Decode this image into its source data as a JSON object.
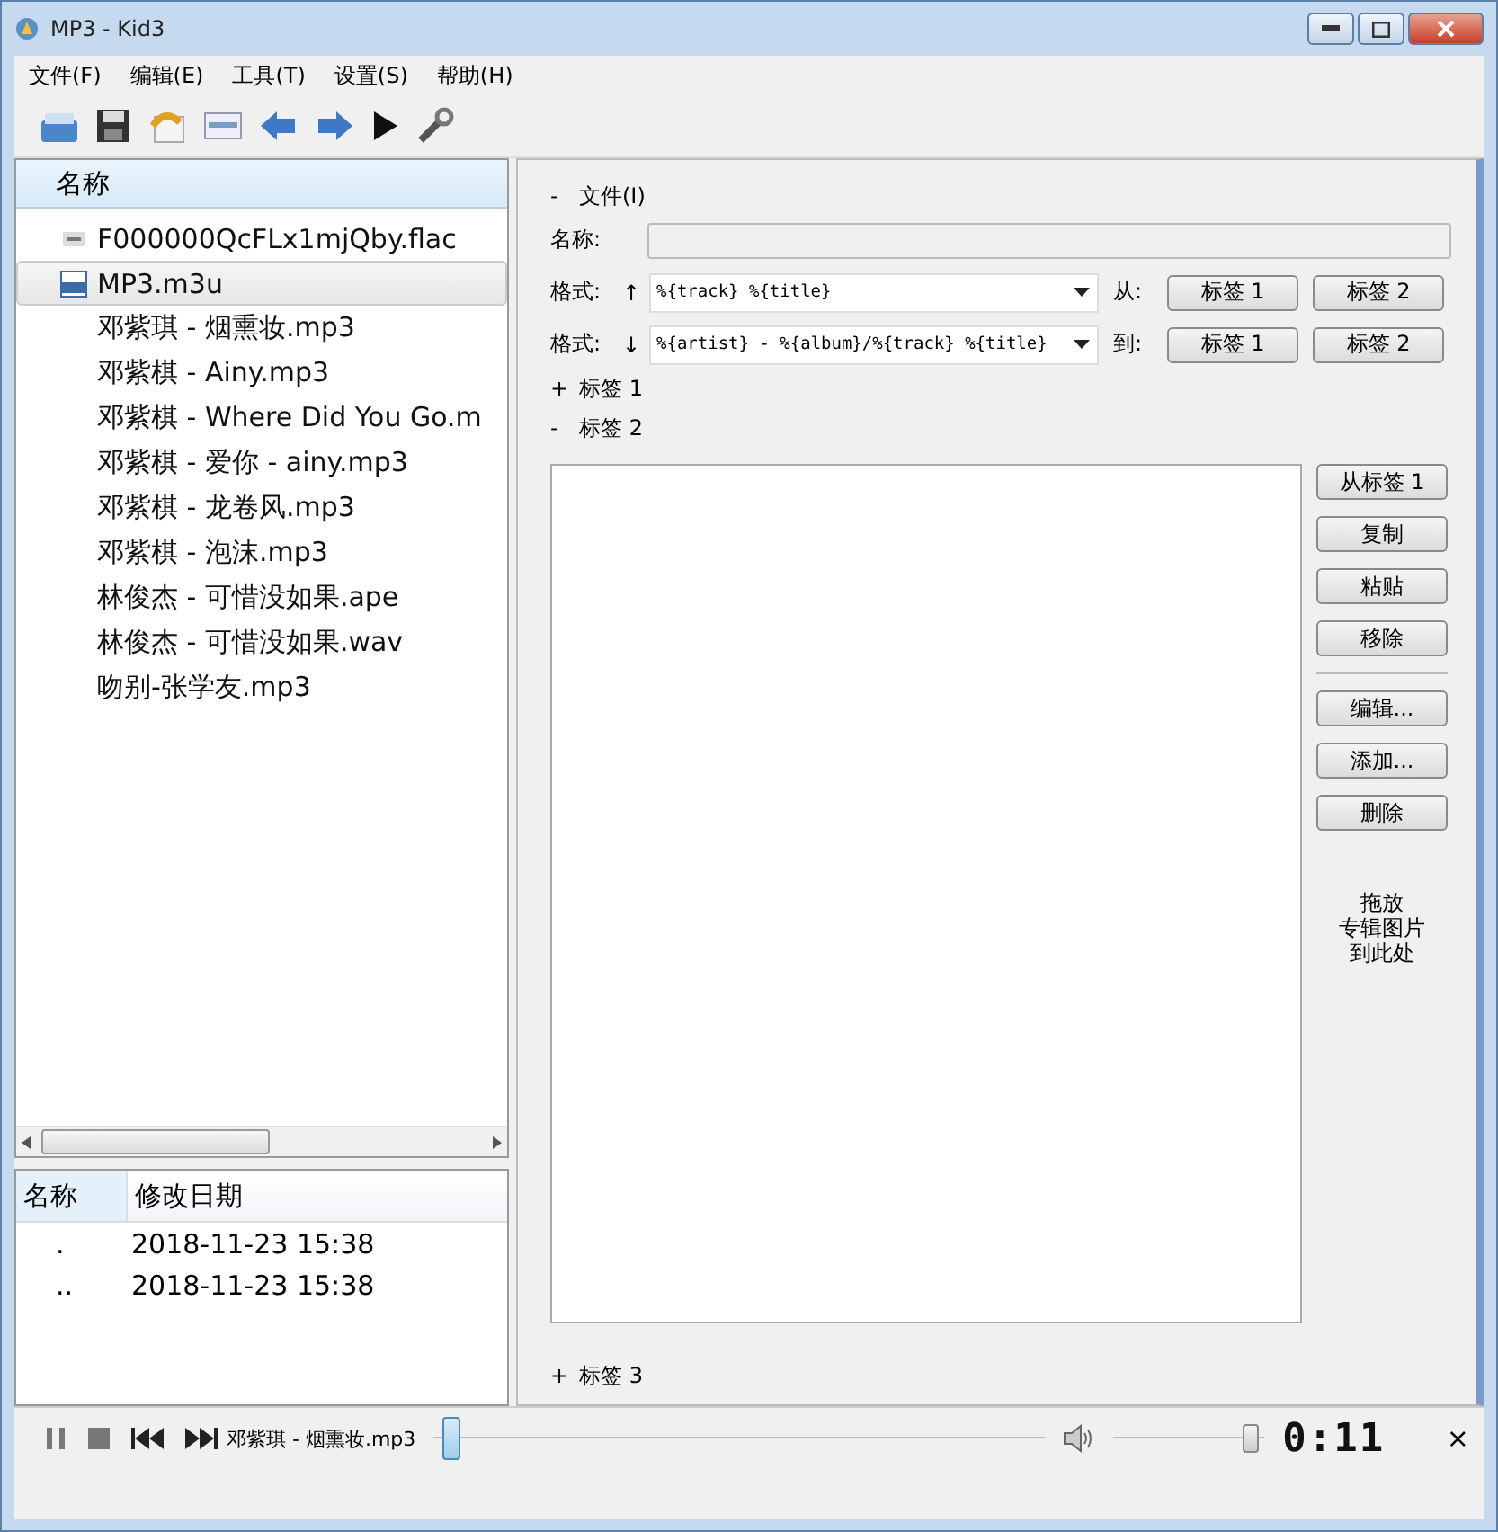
{
  "window": {
    "title": "MP3 - Kid3"
  },
  "menu": [
    "文件(F)",
    "编辑(E)",
    "工具(T)",
    "设置(S)",
    "帮助(H)"
  ],
  "file_list": {
    "header": "名称",
    "items": [
      {
        "name": "F000000QcFLx1mjQby.flac",
        "kind": "tagged",
        "selected": false
      },
      {
        "name": "MP3.m3u",
        "kind": "playlist",
        "selected": true
      },
      {
        "name": "邓紫琪 - 烟熏妆.mp3",
        "kind": "plain",
        "selected": false
      },
      {
        "name": "邓紫棋 - Ainy.mp3",
        "kind": "plain",
        "selected": false
      },
      {
        "name": "邓紫棋 - Where Did You Go.m",
        "kind": "plain",
        "selected": false
      },
      {
        "name": "邓紫棋 - 爱你 - ainy.mp3",
        "kind": "plain",
        "selected": false
      },
      {
        "name": "邓紫棋 - 龙卷风.mp3",
        "kind": "plain",
        "selected": false
      },
      {
        "name": "邓紫棋 - 泡沫.mp3",
        "kind": "plain",
        "selected": false
      },
      {
        "name": "林俊杰 - 可惜没如果.ape",
        "kind": "plain",
        "selected": false
      },
      {
        "name": "林俊杰 - 可惜没如果.wav",
        "kind": "plain",
        "selected": false
      },
      {
        "name": "吻别-张学友.mp3",
        "kind": "plain",
        "selected": false
      }
    ]
  },
  "dir_list": {
    "columns": [
      "名称",
      "修改日期"
    ],
    "rows": [
      [
        ".",
        "2018-11-23 15:38"
      ],
      [
        "..",
        "2018-11-23 15:38"
      ]
    ]
  },
  "file_section": {
    "toggle": "-",
    "title": "文件(I)",
    "name_label": "名称:",
    "format_rows": [
      {
        "label": "格式:",
        "arrow": "↑",
        "value": "%{track} %{title}",
        "dir_label": "从:",
        "buttons": [
          "标签 1",
          "标签 2"
        ]
      },
      {
        "label": "格式:",
        "arrow": "↓",
        "value": "%{artist} - %{album}/%{track} %{title}",
        "dir_label": "到:",
        "buttons": [
          "标签 1",
          "标签 2"
        ]
      }
    ]
  },
  "tag1": {
    "toggle": "+",
    "title": "标签 1"
  },
  "tag2": {
    "toggle": "-",
    "title": "标签 2",
    "buttons": [
      "从标签 1",
      "复制",
      "粘贴",
      "移除"
    ],
    "buttons2": [
      "编辑...",
      "添加...",
      "删除"
    ],
    "drop_hint": [
      "拖放",
      "专辑图片",
      "到此处"
    ]
  },
  "tag3": {
    "toggle": "+",
    "title": "标签 3"
  },
  "player": {
    "track": "邓紫琪 - 烟熏妆.mp3",
    "position": {
      "level": 0.03
    },
    "volume": {
      "level": 0.9
    },
    "time": "0:11",
    "close": "×"
  }
}
